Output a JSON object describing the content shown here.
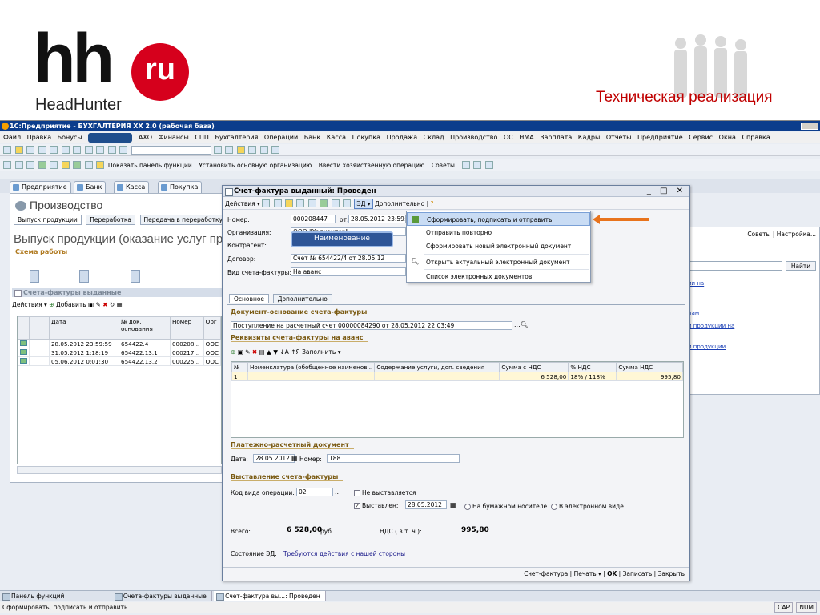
{
  "slide": {
    "logo_main": "hh",
    "logo_badge": "ru",
    "logo_sub": "HeadHunter",
    "title": "Техническая реализация"
  },
  "app": {
    "title": "1С:Предприятие - БУХГАЛТЕРИЯ XX 2.0 (рабочая база)",
    "menu": [
      "Файл",
      "Правка",
      "Бонусы",
      "АХО",
      "Финансы",
      "СПП",
      "Бухгалтерия",
      "Операции",
      "Банк",
      "Касса",
      "Покупка",
      "Продажа",
      "Склад",
      "Производство",
      "ОС",
      "НМА",
      "Зарплата",
      "Кадры",
      "Отчеты",
      "Предприятие",
      "Сервис",
      "Окна",
      "Справка"
    ],
    "toolbar2_items": [
      "Показать панель функций",
      "Установить основную организацию",
      "Ввести хозяйственную операцию",
      "Советы"
    ],
    "tabs": [
      "Предприятие",
      "Банк",
      "Касса",
      "Покупка"
    ]
  },
  "left_panel": {
    "title": "Производство",
    "subtabs": [
      "Выпуск продукции",
      "Переработка",
      "Передача в переработку"
    ],
    "big_title": "Выпуск продукции (оказание услуг про",
    "scheme": "Схема работы",
    "list_header": "Счета-фактуры выданные",
    "actions": "Действия",
    "add": "Добавить",
    "columns": [
      "Дата",
      "№ док. основания",
      "Номер",
      "Орг"
    ],
    "rows": [
      {
        "date": "28.05.2012 23:59:59",
        "doc": "654422.4",
        "num": "000208...",
        "org": "ООС"
      },
      {
        "date": "31.05.2012 1:18:19",
        "doc": "654422.13.1",
        "num": "000217...",
        "org": "ООС"
      },
      {
        "date": "05.06.2012 0:01:30",
        "doc": "654422.13.2",
        "num": "000225...",
        "org": "ООС"
      }
    ]
  },
  "right_panel": {
    "tips": "Советы",
    "settings": "Настройка...",
    "find": "Найти",
    "links": [
      "ии на",
      "пам",
      "и продукции на",
      "и продукции"
    ]
  },
  "dialog": {
    "title": "Счет-фактура выданный: Проведен",
    "actions": "Действия",
    "ed_menu": "ЭД",
    "more": "Дополнительно",
    "fields": {
      "number_label": "Номер:",
      "number": "000208447",
      "from_label": "от:",
      "from": "28.05.2012 23:59:59",
      "org_label": "Организация:",
      "org": "ООО \"Хэдхантер\"",
      "contractor_label": "Контрагент:",
      "contract_label": "Договор:",
      "contract": "Счет № 654422/4 от 28.05.12",
      "kind_label": "Вид счета-фактуры:",
      "kind": "На аванс"
    },
    "name_badge": "Наименование",
    "dropdown": [
      "Сформировать, подписать и отправить",
      "Отправить повторно",
      "Сформировать новый электронный документ",
      "Открыть актуальный электронный документ",
      "Список электронных документов"
    ],
    "tabs": [
      "Основное",
      "Дополнительно"
    ],
    "basis_title": "Документ-основание счета-фактуры",
    "basis_value": "Поступление на расчетный счет 00000084290 от 28.05.2012 22:03:49",
    "req_title": "Реквизиты счета-фактуры на аванс",
    "fill": "Заполнить",
    "table_columns": [
      "№",
      "Номенклатура (обобщенное наименов...",
      "Содержание услуги, доп. сведения",
      "Сумма с НДС",
      "% НДС",
      "Сумма НДС"
    ],
    "table_rows": [
      {
        "n": "1",
        "item": "",
        "content": "",
        "sum": "6 528,00",
        "vat_pct": "18% / 118%",
        "vat_sum": "995,80"
      }
    ],
    "payment_title": "Платежно-расчетный документ",
    "date_label": "Дата:",
    "date": "28.05.2012",
    "num_label": "Номер:",
    "num": "188",
    "issue_title": "Выставление счета-фактуры",
    "opcode_label": "Код вида операции:",
    "opcode": "02",
    "not_issued": "Не выставляется",
    "issued": "Выставлен:",
    "issued_date": "28.05.2012",
    "paper": "На бумажном носителе",
    "electronic": "В электронном виде",
    "total_label": "Всего:",
    "total": "6 528,00",
    "currency": "руб",
    "vat_label": "НДС ( в т. ч.):",
    "vat": "995,80",
    "ed_state_label": "Состояние ЭД:",
    "ed_state": "Требуются действия с нашей стороны",
    "bottom": {
      "invoice": "Счет-фактура",
      "print": "Печать",
      "ok": "OK",
      "save": "Записать",
      "close": "Закрыть"
    }
  },
  "taskbar": [
    "Панель функций",
    "Счета-фактуры выданные",
    "Счет-фактура вы...: Проведен"
  ],
  "status": {
    "text": "Сформировать, подписать и отправить",
    "cap": "CAP",
    "num": "NUM"
  }
}
